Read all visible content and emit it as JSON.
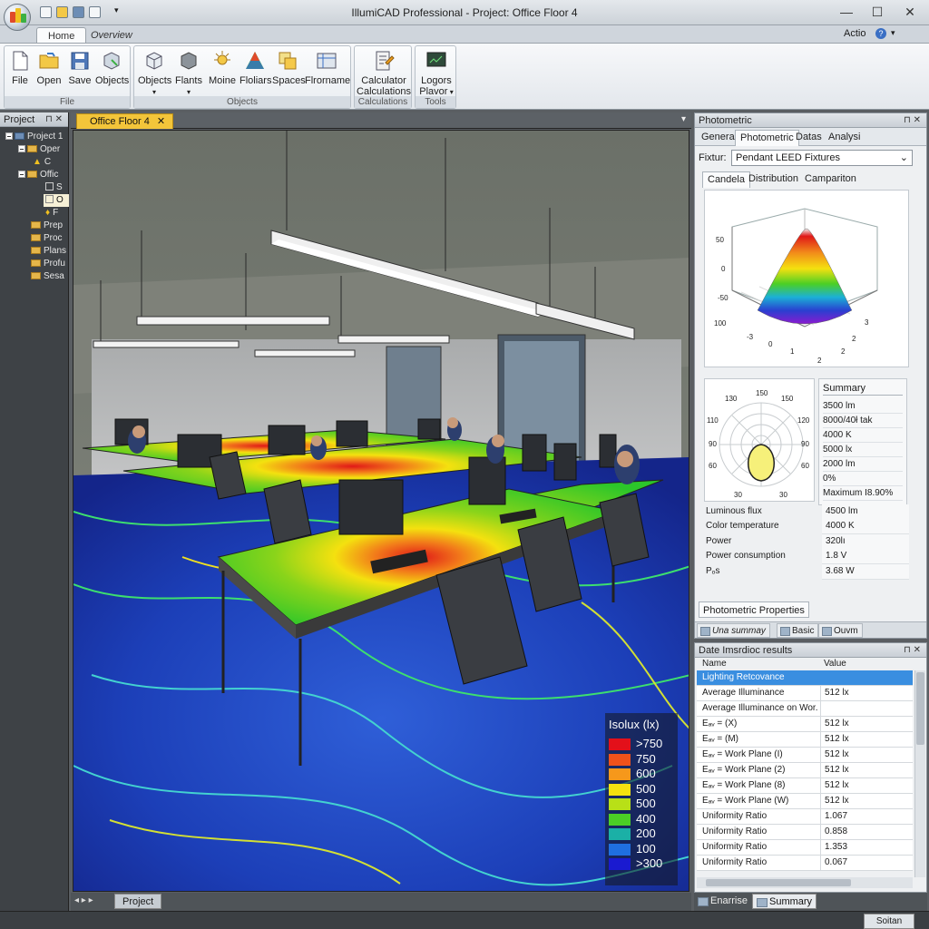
{
  "window": {
    "title": "IllumiCAD Professional - Project: Office Floor 4",
    "minimize": "—",
    "maximize": "☐",
    "close": "✕",
    "action_menu": "Actio",
    "help": "?"
  },
  "ribbon": {
    "tabs": [
      "Home",
      "Overview"
    ],
    "groups": [
      {
        "label": "File",
        "buttons": [
          "File",
          "Open",
          "Save",
          "Objects"
        ]
      },
      {
        "label": "Objects",
        "buttons": [
          "Objects",
          "Flants",
          "Moine",
          "Floliars",
          "Spaces",
          "Flrorname"
        ]
      },
      {
        "label": "Calculations",
        "buttons": [
          "Calculator",
          "Calculations"
        ]
      },
      {
        "label": "Tools",
        "buttons": [
          "Logors",
          "Plavor"
        ]
      }
    ]
  },
  "left_panel": {
    "title": "Project",
    "items": [
      "Project 1",
      "Oper",
      "C",
      "Offic",
      "S",
      "O",
      "F",
      "Prep",
      "Proc",
      "Plans",
      "Profu",
      "Sesa"
    ]
  },
  "document": {
    "tab": "Office Floor 4",
    "footer_tab": "Project"
  },
  "legend": {
    "title": "Isolux (lx)",
    "entries": [
      {
        "label": ">750",
        "color": "#e3101a"
      },
      {
        "label": "750",
        "color": "#f0521a"
      },
      {
        "label": "600",
        "color": "#f6981b"
      },
      {
        "label": "500",
        "color": "#f4e10f"
      },
      {
        "label": "500",
        "color": "#b8e017"
      },
      {
        "label": "400",
        "color": "#4bcf25"
      },
      {
        "label": "200",
        "color": "#1bb0a6"
      },
      {
        "label": "100",
        "color": "#1f6fe0"
      },
      {
        "label": ">300",
        "color": "#1a1ad0"
      }
    ]
  },
  "photometric": {
    "title": "Photometric",
    "tabs": [
      "General",
      "Photometric",
      "Datas",
      "Analysi"
    ],
    "fixture_label": "Fixtur:",
    "fixture_value": "Pendant LEED Fixtures",
    "subtabs": [
      "Candela",
      "Distribution",
      "Campariton"
    ],
    "cone_axis": {
      "z": [
        "50",
        "0",
        "-50",
        "100"
      ],
      "x": [
        "-3",
        "0",
        "1",
        "2"
      ],
      "y": [
        "3",
        "2",
        "2"
      ]
    },
    "polar_axis": {
      "top": [
        "150",
        "130",
        "150"
      ],
      "left": [
        "110",
        "90",
        "60",
        "30"
      ],
      "right": [
        "120",
        "90",
        "60",
        "30"
      ]
    },
    "summary_title": "Summary",
    "summary_values": [
      "3500 lm",
      "8000/40ł tak",
      "4000 K",
      "5000 lx",
      "2000 lm",
      "0%",
      "Maximum I8.90%"
    ],
    "properties": [
      {
        "key": "Luminous flux",
        "value": "4500 lm"
      },
      {
        "key": "Color temperature",
        "value": "4000 K"
      },
      {
        "key": "Power",
        "value": "320lı"
      },
      {
        "key": "Power consumption",
        "value": "1.8 V"
      },
      {
        "key": "Pₒs",
        "value": "3.68 W"
      }
    ],
    "properties_tab": "Photometric Properties",
    "footer_tabs": [
      "Una summay",
      "Basic",
      "Ouvm"
    ]
  },
  "results": {
    "title": "Date Imsrdioc results",
    "columns": [
      "Name",
      "Value"
    ],
    "rows": [
      {
        "name": "Lighting Retcovance",
        "value": ""
      },
      {
        "name": "Average Illuminance",
        "value": "512 lx"
      },
      {
        "name": "Average Illuminance on Wor...",
        "value": ""
      },
      {
        "name": "Eₐᵥ = (X)",
        "value": "512 lx"
      },
      {
        "name": "Eₐᵥ = (M)",
        "value": "512 lx"
      },
      {
        "name": "Eₐᵥ = Work Plane (I)",
        "value": "512 lx"
      },
      {
        "name": "Eₐᵥ = Work Plane (2)",
        "value": "512 lx"
      },
      {
        "name": "Eₐᵥ = Work Plane (8)",
        "value": "512 lx"
      },
      {
        "name": "Eₐᵥ = Work Plane (W)",
        "value": "512 lx"
      },
      {
        "name": "Uniformity Ratio",
        "value": "1.067"
      },
      {
        "name": "Uniformity Ratio",
        "value": "0.858"
      },
      {
        "name": "Uniformity Ratio",
        "value": "1.353"
      },
      {
        "name": "Uniformity Ratio",
        "value": "0.067"
      }
    ],
    "footer_tabs": [
      "Enarrise",
      "Summary"
    ]
  },
  "status": {
    "button": "Soitan"
  }
}
